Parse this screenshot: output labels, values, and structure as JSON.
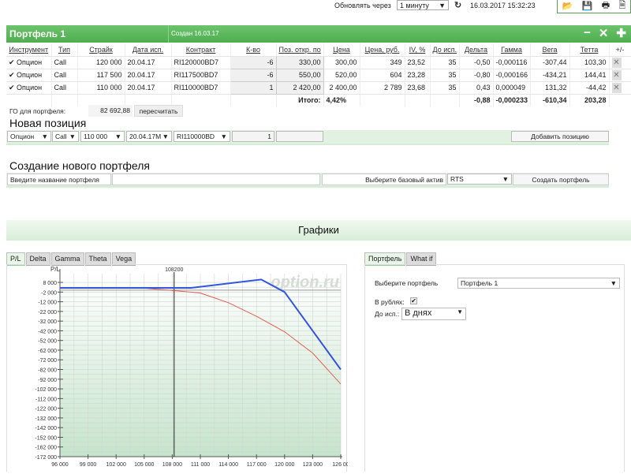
{
  "topbar": {
    "refresh_label": "Обновлять через",
    "refresh_value": "1 минуту",
    "datetime": "16.03.2017 15:32:23",
    "toolbox_icons": [
      "open-folder-icon",
      "save-icon",
      "print-icon",
      "export-icon"
    ]
  },
  "portfolio": {
    "title": "Портфель 1",
    "created": "Создан 16.03.17",
    "actions": [
      "−",
      "✕",
      "✚"
    ],
    "columns": [
      "Инструмент",
      "Тип",
      "Страйк",
      "Дата исп.",
      "Контракт",
      "К-во",
      "Поз. откр. по",
      "Цена",
      "Цена, руб.",
      "IV, %",
      "До исп.",
      "Дельта",
      "Гамма",
      "Вега",
      "Тетта",
      "+/-"
    ],
    "rows": [
      {
        "checked": true,
        "instrument": "Опцион",
        "type": "Call",
        "strike": "120 000",
        "date": "20.04.17",
        "contract": "RI120000BD7",
        "qty": "-6",
        "open": "330,00",
        "price": "300,00",
        "price_rub": "349",
        "iv": "23,52",
        "days": "35",
        "delta": "-0,50",
        "gamma": "-0,000116",
        "vega": "-307,44",
        "theta": "103,30"
      },
      {
        "checked": true,
        "instrument": "Опцион",
        "type": "Call",
        "strike": "117 500",
        "date": "20.04.17",
        "contract": "RI117500BD7",
        "qty": "-6",
        "open": "550,00",
        "price": "520,00",
        "price_rub": "604",
        "iv": "23,28",
        "days": "35",
        "delta": "-0,80",
        "gamma": "-0,000166",
        "vega": "-434,21",
        "theta": "144,41"
      },
      {
        "checked": true,
        "instrument": "Опцион",
        "type": "Call",
        "strike": "110 000",
        "date": "20.04.17",
        "contract": "RI110000BD7",
        "qty": "1",
        "open": "2 420,00",
        "price": "2 400,00",
        "price_rub": "2 789",
        "iv": "23,68",
        "days": "35",
        "delta": "0,43",
        "gamma": "0,000049",
        "vega": "131,32",
        "theta": "-44,42"
      }
    ],
    "totals": {
      "label": "Итого:",
      "price": "4,42%",
      "delta": "-0,88",
      "gamma": "-0,000233",
      "vega": "-610,34",
      "theta": "203,28"
    },
    "go_label": "ГО для портфеля:",
    "go_value": "82 692,88",
    "recalc": "пересчитать"
  },
  "new_position": {
    "title": "Новая позиция",
    "instrument": "Опцион",
    "type": "Call",
    "strike": "110 000",
    "date": "20.04.17M",
    "contract": "RI110000BD",
    "qty": "1",
    "add": "Добавить позицию"
  },
  "create_portfolio": {
    "title": "Создание нового портфеля",
    "name_label": "Введите название портфеля",
    "name_value": "",
    "asset_label": "Выберите базовый актив",
    "asset": "RTS",
    "create": "Создать портфель"
  },
  "graphs": {
    "title": "Графики",
    "tabs": [
      "P/L",
      "Delta",
      "Gamma",
      "Theta",
      "Vega"
    ],
    "active_tab": "P/L",
    "right_tabs": [
      "Портфель",
      "What if"
    ],
    "active_right_tab": "Портфель",
    "select_portfolio_label": "Выберите портфель",
    "select_portfolio": "Портфель 1",
    "rubles_label": "В рублях:",
    "rubles_checked": true,
    "expiry_label": "До исп.:",
    "expiry_value": "В днях"
  },
  "chart_data": {
    "type": "line",
    "ylabel": "P/L",
    "watermark": "option.ru",
    "marker_label": "108200",
    "marker_x": 108200,
    "xlim": [
      96000,
      126000
    ],
    "ylim": [
      -172000,
      17000
    ],
    "grid": true,
    "x_ticks": [
      "96 000",
      "99 000",
      "102 000",
      "105 000",
      "108 000",
      "111 000",
      "114 000",
      "117 000",
      "120 000",
      "123 000",
      "126 00"
    ],
    "y_ticks": [
      "8 000",
      "-2 000",
      "-12 000",
      "-22 000",
      "-32 000",
      "-42 000",
      "-52 000",
      "-62 000",
      "-72 000",
      "-82 000",
      "-92 000",
      "-102 000",
      "-112 000",
      "-122 000",
      "-132 000",
      "-142 000",
      "-152 000",
      "-162 000",
      "-172 000"
    ],
    "series": [
      {
        "color": "#3355dd",
        "points": [
          [
            96000,
            2300
          ],
          [
            110000,
            2300
          ],
          [
            117500,
            11000
          ],
          [
            120000,
            -2000
          ],
          [
            126000,
            -82000
          ]
        ]
      },
      {
        "color": "#e06050",
        "points": [
          [
            96000,
            2300
          ],
          [
            105000,
            2000
          ],
          [
            108200,
            -500
          ],
          [
            111000,
            -3000
          ],
          [
            114000,
            -13000
          ],
          [
            117000,
            -27000
          ],
          [
            120000,
            -43000
          ],
          [
            123000,
            -65000
          ],
          [
            126000,
            -97000
          ]
        ]
      }
    ],
    "zero_line": 0
  }
}
